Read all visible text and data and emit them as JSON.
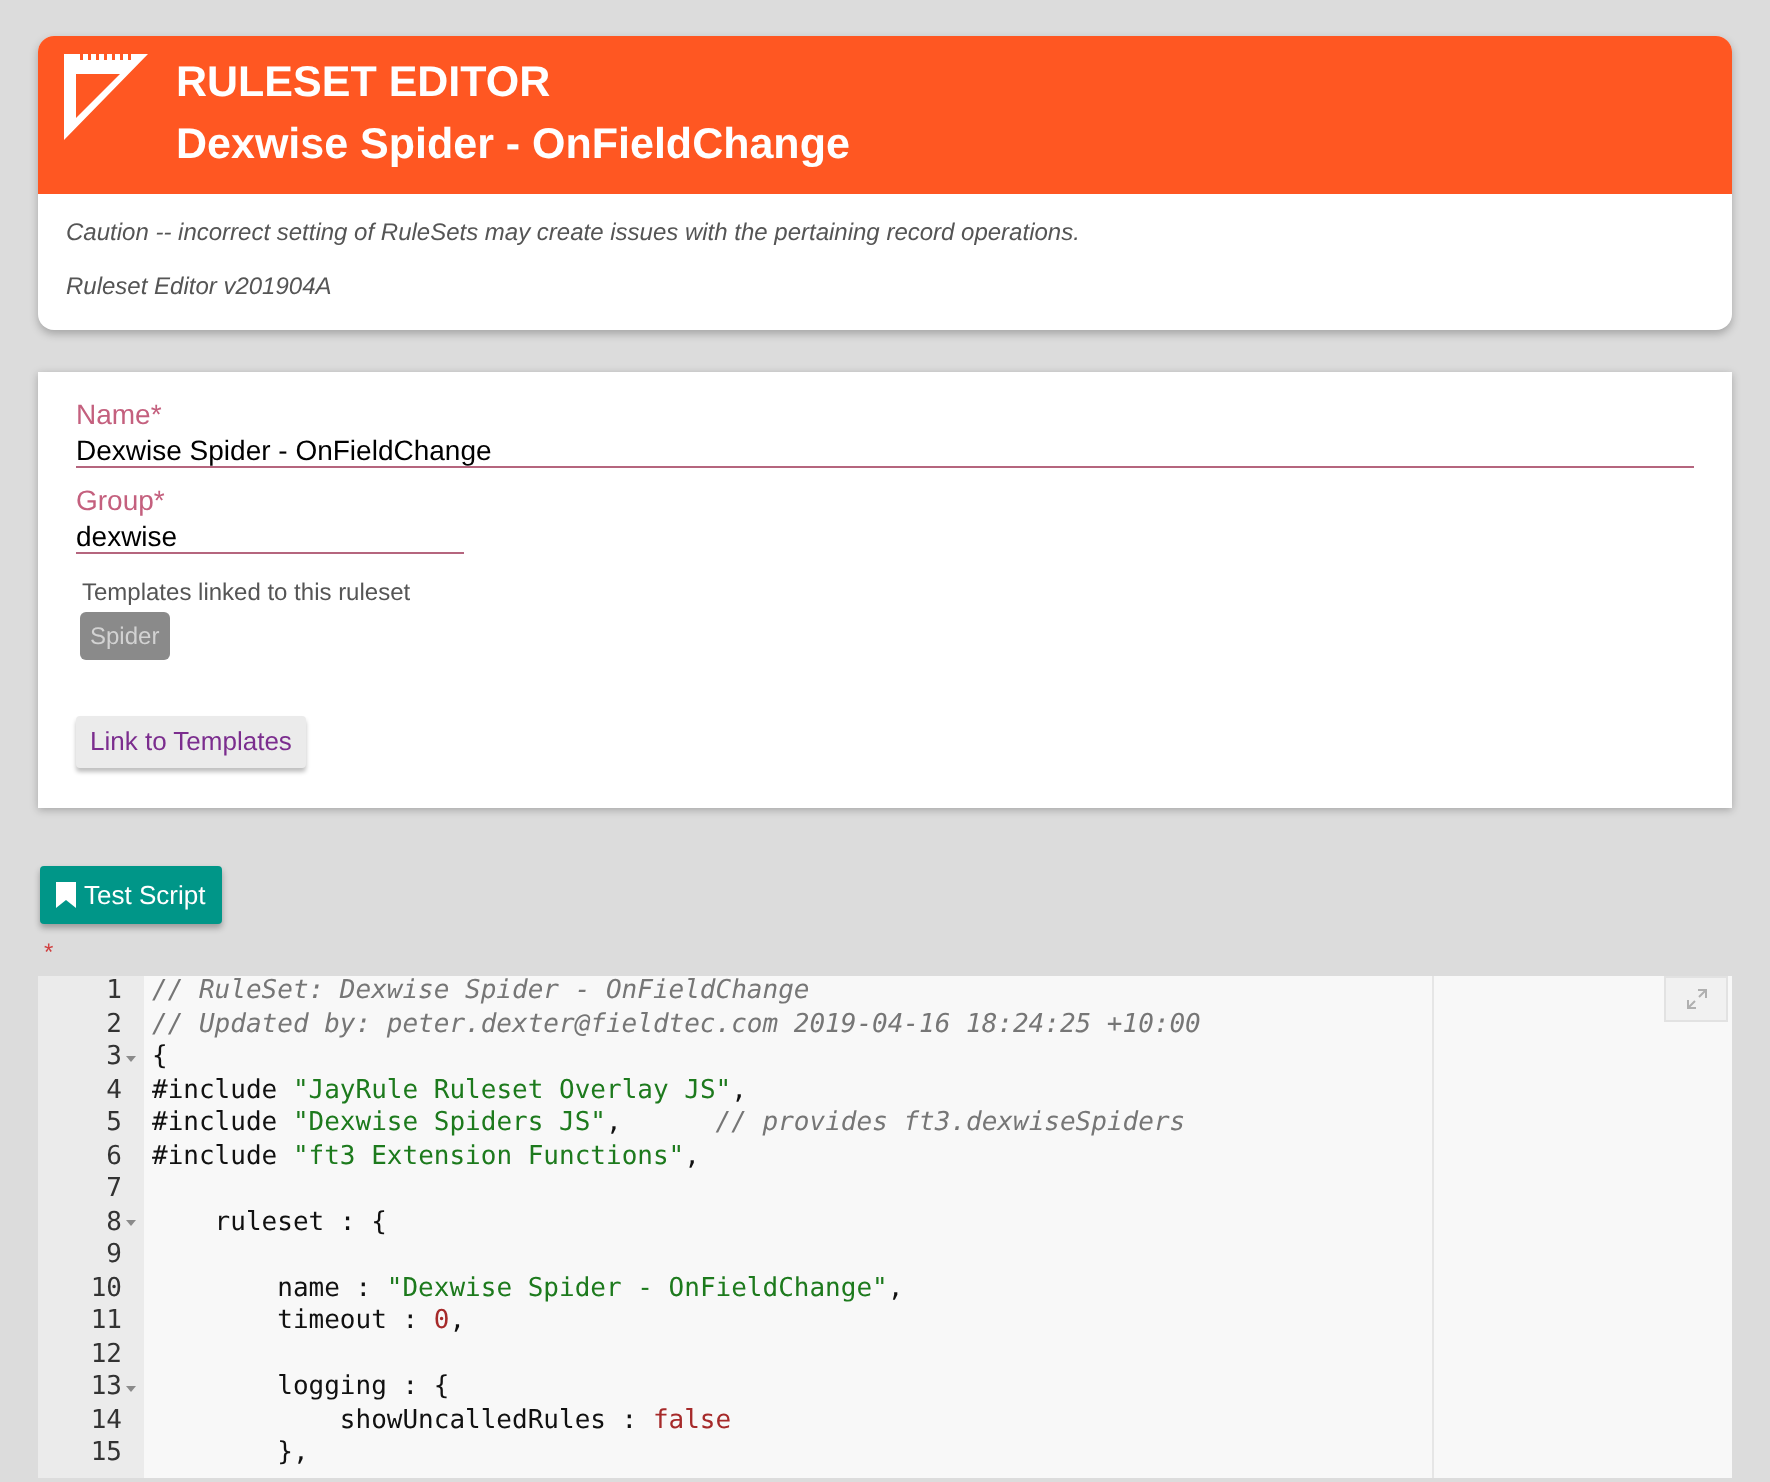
{
  "header": {
    "title": "RULESET EDITOR",
    "subtitle": "Dexwise Spider - OnFieldChange",
    "caution": "Caution -- incorrect setting of RuleSets may create issues with the pertaining record operations.",
    "version": "Ruleset Editor v201904A"
  },
  "form": {
    "name_field": {
      "label": "Name*",
      "value": "Dexwise Spider - OnFieldChange"
    },
    "group_field": {
      "label": "Group*",
      "value": "dexwise"
    },
    "templates": {
      "label": "Templates linked to this ruleset",
      "chips": [
        "Spider"
      ]
    },
    "link_button": "Link to Templates"
  },
  "test_button": "Test Script",
  "required_mark": "*",
  "editor": {
    "lines": [
      {
        "number": "1",
        "foldable": false,
        "tokens": [
          {
            "kind": "comment",
            "text": "// RuleSet: Dexwise Spider - OnFieldChange"
          }
        ]
      },
      {
        "number": "2",
        "foldable": false,
        "tokens": [
          {
            "kind": "comment",
            "text": "// Updated by: peter.dexter@fieldtec.com 2019-04-16 18:24:25 +10:00"
          }
        ]
      },
      {
        "number": "3",
        "foldable": true,
        "tokens": [
          {
            "kind": "plain",
            "text": "{"
          }
        ]
      },
      {
        "number": "4",
        "foldable": false,
        "tokens": [
          {
            "kind": "plain",
            "text": "#include "
          },
          {
            "kind": "string",
            "text": "\"JayRule Ruleset Overlay JS\""
          },
          {
            "kind": "plain",
            "text": ","
          }
        ]
      },
      {
        "number": "5",
        "foldable": false,
        "tokens": [
          {
            "kind": "plain",
            "text": "#include "
          },
          {
            "kind": "string",
            "text": "\"Dexwise Spiders JS\""
          },
          {
            "kind": "plain",
            "text": ",      "
          },
          {
            "kind": "comment",
            "text": "// provides ft3.dexwiseSpiders"
          }
        ]
      },
      {
        "number": "6",
        "foldable": false,
        "tokens": [
          {
            "kind": "plain",
            "text": "#include "
          },
          {
            "kind": "string",
            "text": "\"ft3 Extension Functions\""
          },
          {
            "kind": "plain",
            "text": ","
          }
        ]
      },
      {
        "number": "7",
        "foldable": false
      },
      {
        "number": "8",
        "foldable": true,
        "tokens": [
          {
            "kind": "plain",
            "text": "    ruleset : {"
          }
        ]
      },
      {
        "number": "9",
        "foldable": false
      },
      {
        "number": "10",
        "foldable": false,
        "tokens": [
          {
            "kind": "plain",
            "text": "        name : "
          },
          {
            "kind": "string",
            "text": "\"Dexwise Spider - OnFieldChange\""
          },
          {
            "kind": "plain",
            "text": ","
          }
        ]
      },
      {
        "number": "11",
        "foldable": false,
        "tokens": [
          {
            "kind": "plain",
            "text": "        timeout : "
          },
          {
            "kind": "constant",
            "text": "0"
          },
          {
            "kind": "plain",
            "text": ","
          }
        ]
      },
      {
        "number": "12",
        "foldable": false
      },
      {
        "number": "13",
        "foldable": true,
        "tokens": [
          {
            "kind": "plain",
            "text": "        logging : {"
          }
        ]
      },
      {
        "number": "14",
        "foldable": false,
        "tokens": [
          {
            "kind": "plain",
            "text": "            showUncalledRules : "
          },
          {
            "kind": "constant",
            "text": "false"
          }
        ]
      },
      {
        "number": "15",
        "foldable": false,
        "tokens": [
          {
            "kind": "plain",
            "text": "        },"
          }
        ]
      }
    ]
  }
}
